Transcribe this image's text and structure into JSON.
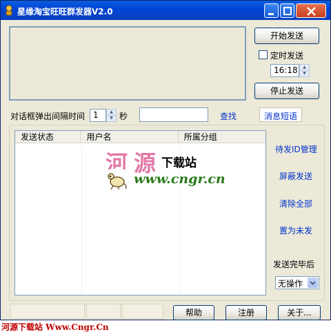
{
  "window": {
    "title": "星缘淘宝旺旺群发器V2.0"
  },
  "controls": {
    "start_send": "开始发送",
    "timer_label": "定时发送",
    "timer_value": "16:18",
    "stop_send": "停止发送",
    "interval_label": "对话框弹出间隔时间",
    "interval_value": "1",
    "interval_unit": "秒",
    "search_value": "",
    "search_link": "查找",
    "message_tab": "消息短语"
  },
  "list": {
    "columns": [
      "发送状态",
      "用户名",
      "所属分组"
    ]
  },
  "side_links": {
    "pending_ids": "待发ID管理",
    "block_send": "屏蔽发送",
    "clear_all": "清除全部",
    "set_unsent": "置为未发",
    "after_label": "发送完毕后",
    "after_value": "无操作"
  },
  "footer": {
    "help": "帮助",
    "register": "注册",
    "about": "关于..."
  },
  "watermark": {
    "he": "河",
    "yuan": "源",
    "sub": "下载站",
    "url": "www.cngr.cn"
  },
  "bottom_banner": "河源下载站 Www.Cngr.Cn",
  "colors": {
    "title_blue": "#0046d5",
    "link_blue": "#0033cc",
    "watermark_pink": "#e07aa7",
    "watermark_green": "#2a7a1a",
    "banner_red": "#c00000"
  }
}
